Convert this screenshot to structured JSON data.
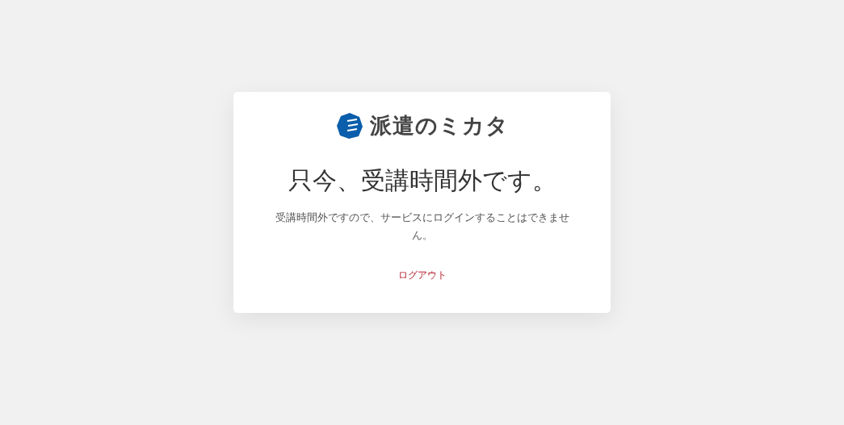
{
  "logo": {
    "text": "派遣のミカタ"
  },
  "heading": "只今、受講時間外です。",
  "message": "受講時間外ですので、サービスにログインすることはできません。",
  "logout_link": "ログアウト"
}
